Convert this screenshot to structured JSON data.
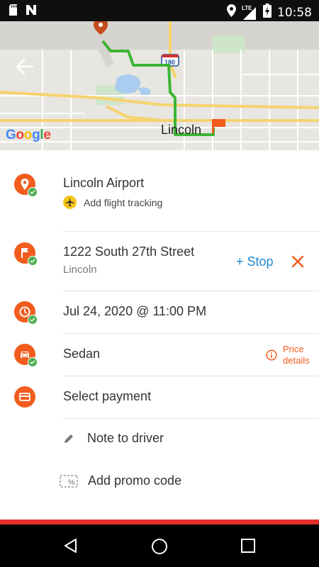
{
  "status_bar": {
    "time": "10:58",
    "network": "LTE"
  },
  "map": {
    "city_label": "Lincoln",
    "interstate": "180",
    "attribution": [
      "G",
      "o",
      "o",
      "g",
      "l",
      "e"
    ]
  },
  "pickup": {
    "title": "Lincoln Airport",
    "action": "Add flight tracking"
  },
  "destination": {
    "street": "1222 South 27th Street",
    "city": "Lincoln",
    "stop_label": "+ Stop"
  },
  "schedule": {
    "datetime": "Jul 24, 2020 @ 11:00 PM"
  },
  "vehicle": {
    "type": "Sedan",
    "price_line1": "Price",
    "price_line2": "details"
  },
  "payment": {
    "label": "Select payment"
  },
  "note": {
    "label": "Note to driver"
  },
  "promo": {
    "label": "Add promo code"
  },
  "colors": {
    "accent": "#f25c1d",
    "link": "#1e88d2",
    "success": "#4caf50",
    "route": "#3db534",
    "brand_red": "#e5302b"
  }
}
